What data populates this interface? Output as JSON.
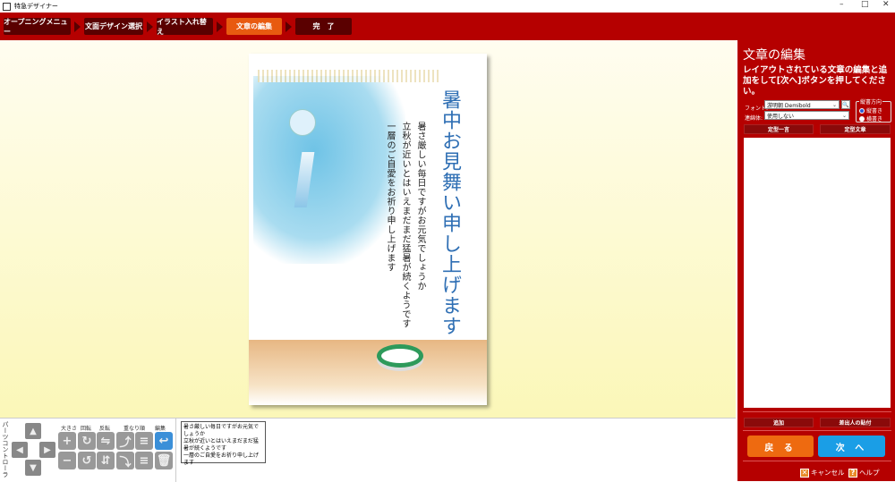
{
  "window": {
    "title": "特急デザイナー",
    "minimize": "–",
    "maximize": "□",
    "close": "✕"
  },
  "steps": [
    {
      "label": "オープニングメニュー",
      "active": false
    },
    {
      "label": "文面デザイン選択",
      "active": false
    },
    {
      "label": "イラスト入れ替え",
      "active": false
    },
    {
      "label": "文章の編集",
      "active": true
    },
    {
      "label": "完　了",
      "active": false
    }
  ],
  "card": {
    "title": "暑中お見舞い申し上げます",
    "body": [
      "暑さ厳しい毎日ですがお元気でしょうか",
      "立秋が近いとはいえまだまだ猛暑が続くようです",
      "一層のご自愛をお祈り申し上げます"
    ]
  },
  "controller": {
    "label": "パーツコントローラ",
    "groups": [
      "大きさ",
      "回転",
      "反転",
      "重なり順",
      "編集"
    ],
    "text": "暑さ厳しい毎日ですがお元気でしょうか\n立秋が近いとはいえまだまだ猛暑が続くようです\n一層のご自愛をお祈り申し上げます"
  },
  "panel": {
    "title": "文章の編集",
    "description": "レイアウトされている文章の編集と追加をして[次へ]ボタンを押してください。",
    "font_label": "フォント:",
    "font_value": "游明朝 Demibold",
    "ligature_label": "連綿体:",
    "ligature_value": "使用しない",
    "direction_label": "縦書方向",
    "direction_options": [
      "縦書き",
      "横書き"
    ],
    "direction_selected": "縦書き",
    "phrase_button": "定型一言",
    "template_button": "定型文章",
    "add_button": "追加",
    "sender_button": "差出人の貼付",
    "back_button": "戻 る",
    "next_button": "次 へ",
    "cancel_label": "キャンセル",
    "help_label": "ヘルプ"
  },
  "colors": {
    "brand_red": "#b50000",
    "active_step": "#e85a10",
    "back": "#ee6a10",
    "next": "#1a9ee6"
  }
}
